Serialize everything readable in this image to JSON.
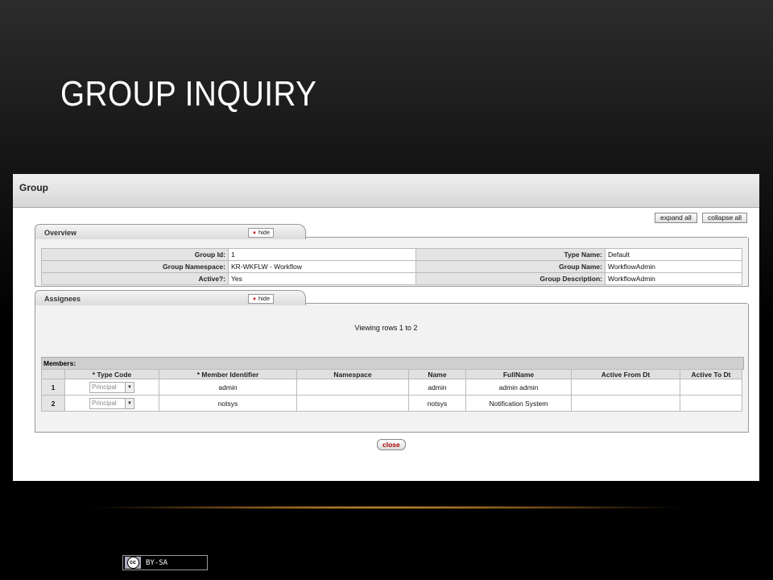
{
  "slide": {
    "title": "GROUP INQUIRY"
  },
  "window": {
    "title": "Group"
  },
  "actions": {
    "expand_all": "expand all",
    "collapse_all": "collapse all",
    "close": "close"
  },
  "overview": {
    "tab_label": "Overview",
    "hide_label": "hide",
    "left": [
      {
        "label": "Group Id:",
        "value": "1"
      },
      {
        "label": "Group Namespace:",
        "value": "KR-WKFLW - Workflow"
      },
      {
        "label": "Active?:",
        "value": "Yes"
      }
    ],
    "right": [
      {
        "label": "Type Name:",
        "value": "Default"
      },
      {
        "label": "Group Name:",
        "value": "WorkflowAdmin"
      },
      {
        "label": "Group Description:",
        "value": "WorkflowAdmin"
      }
    ]
  },
  "assignees": {
    "tab_label": "Assignees",
    "hide_label": "hide",
    "viewing": "Viewing rows 1 to 2",
    "members_label": "Members:",
    "columns": [
      "* Type Code",
      "* Member Identifier",
      "Namespace",
      "Name",
      "FullName",
      "Active From Dt",
      "Active To Dt"
    ],
    "rows": [
      {
        "num": "1",
        "type_code": "Principal",
        "member_identifier": "admin",
        "namespace": "",
        "name": "admin",
        "full_name": "admin admin",
        "active_from": "",
        "active_to": ""
      },
      {
        "num": "2",
        "type_code": "Principal",
        "member_identifier": "notsys",
        "namespace": "",
        "name": "notsys",
        "full_name": "Notification System",
        "active_from": "",
        "active_to": ""
      }
    ]
  },
  "license": {
    "text": "BY-SA",
    "icon": "cc-icon"
  }
}
